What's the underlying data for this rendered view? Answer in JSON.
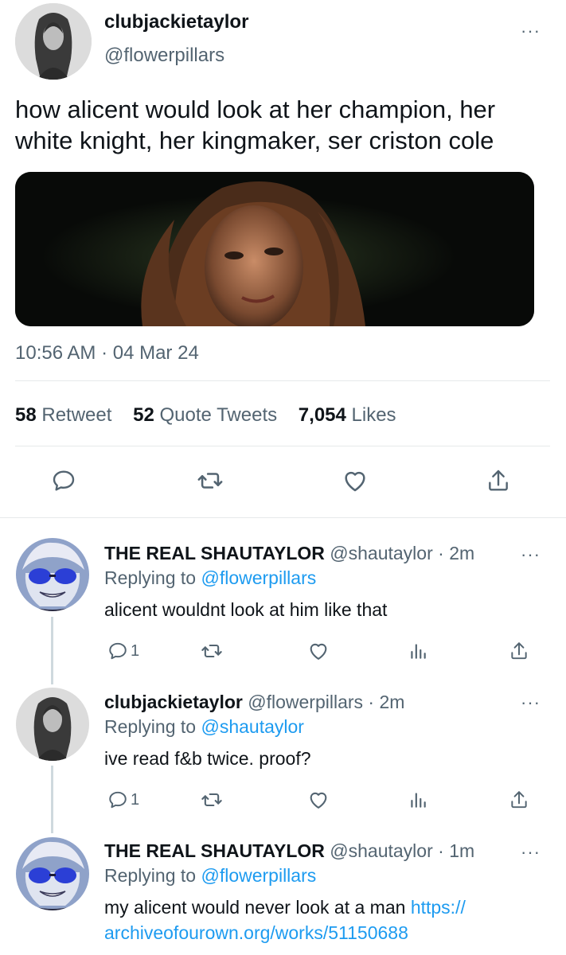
{
  "main_tweet": {
    "display_name": "clubjackietaylor",
    "handle": "@flowerpillars",
    "text": "how alicent would look at her champion, her white knight, her kingmaker, ser criston cole",
    "timestamp": "10:56 AM · 04 Mar 24",
    "stats": {
      "retweets": "58",
      "retweets_label": "Retweet",
      "quotes": "52",
      "quotes_label": "Quote Tweets",
      "likes": "7,054",
      "likes_label": "Likes"
    },
    "actions": [
      "reply-icon",
      "retweet-icon",
      "like-icon",
      "share-icon"
    ],
    "more_label": "···"
  },
  "replies": [
    {
      "display_name": "THE REAL SHAUTAYLOR",
      "handle": "@shautaylor",
      "time": "· 2m",
      "replying_prefix": "Replying to",
      "replying_to": "@flowerpillars",
      "text": "alicent wouldnt look at him like that",
      "reply_count": "1"
    },
    {
      "display_name": "clubjackietaylor",
      "handle": "@flowerpillars",
      "time": "· 2m",
      "replying_prefix": "Replying to",
      "replying_to": "@shautaylor",
      "text": "ive read f&b twice. proof?",
      "reply_count": "1"
    },
    {
      "display_name": "THE REAL SHAUTAYLOR",
      "handle": "@shautaylor",
      "time": "· 1m",
      "replying_prefix": "Replying to",
      "replying_to": "@flowerpillars",
      "text": "my alicent would never look at a man",
      "link": "https://archiveofourown.org/works/51150688",
      "link_line1": "https://",
      "link_line2": "archiveofourown.org/works/51150688"
    }
  ],
  "colors": {
    "text_primary": "#0f1419",
    "text_secondary": "#536471",
    "link": "#1d9bf0",
    "divider": "#e6e9ea"
  }
}
